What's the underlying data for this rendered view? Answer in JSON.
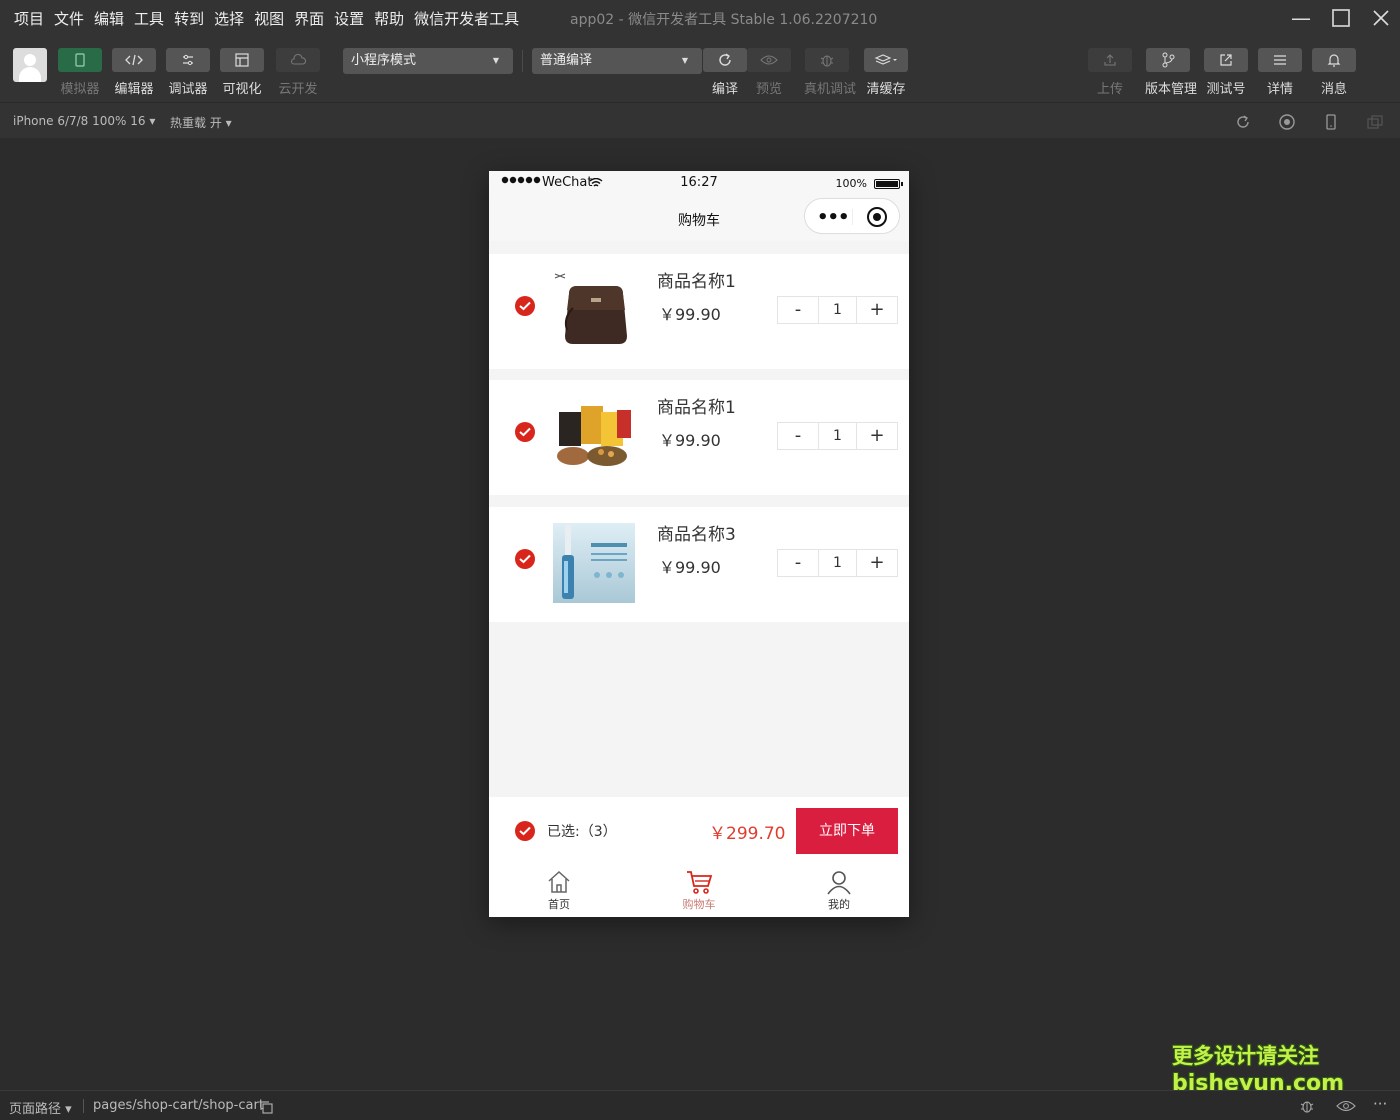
{
  "menu": [
    "项目",
    "文件",
    "编辑",
    "工具",
    "转到",
    "选择",
    "视图",
    "界面",
    "设置",
    "帮助",
    "微信开发者工具"
  ],
  "window_title": "app02 - 微信开发者工具 Stable 1.06.2207210",
  "toolbar": {
    "left_tools": [
      {
        "label": "模拟器",
        "icon": "phone-icon"
      },
      {
        "label": "编辑器",
        "icon": "code-icon"
      },
      {
        "label": "调试器",
        "icon": "debug-icon"
      },
      {
        "label": "可视化",
        "icon": "layout-icon"
      },
      {
        "label": "云开发",
        "icon": "cloud-icon"
      }
    ],
    "mode_select": "小程序模式",
    "compile_select": "普通编译",
    "mid_tools": [
      {
        "label": "编译",
        "icon": "refresh-icon"
      },
      {
        "label": "预览",
        "icon": "eye-icon"
      },
      {
        "label": "真机调试",
        "icon": "bug-icon"
      },
      {
        "label": "清缓存",
        "icon": "layers-icon"
      }
    ],
    "right_tools": [
      {
        "label": "上传",
        "icon": "upload-icon"
      },
      {
        "label": "版本管理",
        "icon": "branch-icon"
      },
      {
        "label": "测试号",
        "icon": "external-link-icon"
      },
      {
        "label": "详情",
        "icon": "menu-icon"
      },
      {
        "label": "消息",
        "icon": "bell-icon"
      }
    ]
  },
  "subbar": {
    "device": "iPhone 6/7/8 100% 16 ▾",
    "hot_reload": "热重载 开 ▾"
  },
  "phone": {
    "status": {
      "carrier": "WeChat",
      "time": "16:27",
      "battery": "100%"
    },
    "nav_title": "购物车",
    "items": [
      {
        "name": "商品名称1",
        "price": "￥99.90",
        "qty": "1",
        "image": "leather-bag"
      },
      {
        "name": "商品名称1",
        "price": "￥99.90",
        "qty": "1",
        "image": "snack-food"
      },
      {
        "name": "商品名称3",
        "price": "￥99.90",
        "qty": "1",
        "image": "serum-bottle"
      }
    ],
    "stepper": {
      "minus": "-",
      "plus": "+"
    },
    "footer": {
      "selected": "已选:（3）",
      "total": "￥299.70",
      "order_button": "立即下单"
    },
    "tabs": [
      {
        "label": "首页",
        "icon": "home-icon"
      },
      {
        "label": "购物车",
        "icon": "cart-icon"
      },
      {
        "label": "我的",
        "icon": "user-icon"
      }
    ]
  },
  "bottom": {
    "page_path_label": "页面路径 ▾",
    "page_path": "pages/shop-cart/shop-cart"
  },
  "watermark": {
    "line1": "更多设计请关注",
    "line2": "bisheyun.com"
  },
  "colors": {
    "accent_red": "#d9261c",
    "order_button": "#d91e3f",
    "price_red": "#e03d2f",
    "ide_bg": "#2c2c2c"
  }
}
